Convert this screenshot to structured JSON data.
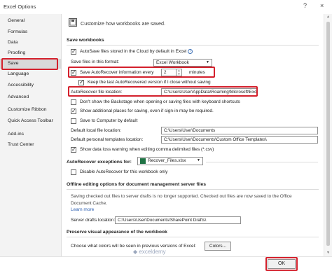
{
  "window": {
    "title": "Excel Options",
    "help": "?",
    "close": "×"
  },
  "sidebar": {
    "items": [
      {
        "label": "General"
      },
      {
        "label": "Formulas"
      },
      {
        "label": "Data"
      },
      {
        "label": "Proofing"
      },
      {
        "label": "Save",
        "selected": true
      },
      {
        "label": "Language"
      },
      {
        "label": "Accessibility"
      },
      {
        "label": "Advanced"
      },
      {
        "label": "Customize Ribbon"
      },
      {
        "label": "Quick Access Toolbar"
      },
      {
        "label": "Add-ins"
      },
      {
        "label": "Trust Center"
      }
    ]
  },
  "main": {
    "heading": "Customize how workbooks are saved.",
    "save_workbooks": {
      "title": "Save workbooks",
      "autosave_cloud": {
        "label": "AutoSave files stored in the Cloud by default in Excel",
        "checked": true
      },
      "format_label": "Save files in this format:",
      "format_value": "Excel Workbook",
      "autorecover_every": {
        "label": "Save AutoRecover information every",
        "checked": true,
        "value": "2",
        "unit": "minutes"
      },
      "keep_last": {
        "label": "Keep the last AutoRecovered version if I close without saving",
        "checked": true
      },
      "autorecover_location_label": "AutoRecover file location:",
      "autorecover_location_value": "C:\\Users\\User\\AppData\\Roaming\\Microsoft\\Excel\\",
      "dont_show_backstage": {
        "label": "Don't show the Backstage when opening or saving files with keyboard shortcuts",
        "checked": false
      },
      "show_additional_places": {
        "label": "Show additional places for saving, even if sign-in may be required.",
        "checked": true
      },
      "save_to_computer": {
        "label": "Save to Computer by default",
        "checked": false
      },
      "default_local_label": "Default local file location:",
      "default_local_value": "C:\\Users\\User\\Documents",
      "default_templates_label": "Default personal templates location:",
      "default_templates_value": "C:\\Users\\User\\Documents\\Custom Office Templates\\",
      "show_data_loss": {
        "label": "Show data loss warning when editing comma delimited files (*.csv)",
        "checked": true
      }
    },
    "autorecover_exceptions": {
      "label": "AutoRecover exceptions for:",
      "workbook": "Recover_Files.xlsx",
      "disable": {
        "label": "Disable AutoRecover for this workbook only",
        "checked": false
      }
    },
    "offline": {
      "title": "Offline editing options for document management server files",
      "text": "Saving checked out files to server drafts is no longer supported. Checked out files are now saved to the Office Document Cache.",
      "learn_more": "Learn more",
      "drafts_label": "Server drafts location:",
      "drafts_value": "C:\\Users\\User\\Documents\\SharePoint Drafts\\"
    },
    "preserve": {
      "title": "Preserve visual appearance of the workbook",
      "colors_label": "Choose what colors will be seen in previous versions of Excel:",
      "colors_button": "Colors..."
    }
  },
  "footer": {
    "ok": "OK"
  },
  "watermark": "exceldemy",
  "colors": {
    "highlight": "#d4202c",
    "selected_nav": "#d9d9d9",
    "link": "#2a5db0"
  }
}
